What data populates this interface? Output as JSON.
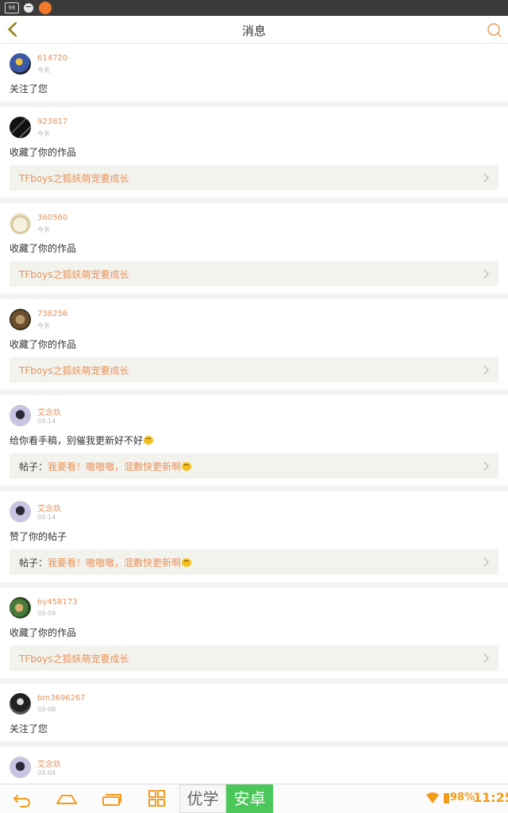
{
  "status_bar": {
    "badge": "96"
  },
  "header": {
    "title": "消息"
  },
  "messages": [
    {
      "user": "614720",
      "time": "今天",
      "action": "关注了您",
      "avatar": "avatar-blue-figure"
    },
    {
      "user": "923817",
      "time": "今天",
      "action": "收藏了你的作品",
      "ref": "TFboys之狐妖萌宠要成长",
      "avatar": "avatar-dark-sketch"
    },
    {
      "user": "360560",
      "time": "今天",
      "action": "收藏了你的作品",
      "ref": "TFboys之狐妖萌宠要成长",
      "avatar": "avatar-cream-cat"
    },
    {
      "user": "738256",
      "time": "今天",
      "action": "收藏了你的作品",
      "ref": "TFboys之狐妖萌宠要成长",
      "avatar": "avatar-brown-photo"
    },
    {
      "user": "艾念玖",
      "time": "03-14",
      "action": "给你看手稿，别催我更新好不好",
      "ref_prefix": "帖子：",
      "ref": "我要看！嗷嗷嗷，混敷快更新啊",
      "avatar": "avatar-girl-lavender"
    },
    {
      "user": "艾念玖",
      "time": "03-14",
      "action": "赞了你的帖子",
      "ref_prefix": "帖子：",
      "ref": "我要看！嗷嗷嗷，混敷快更新啊",
      "avatar": "avatar-girl-lavender"
    },
    {
      "user": "by458173",
      "time": "03-09",
      "action": "收藏了你的作品",
      "ref": "TFboys之狐妖萌宠要成长",
      "avatar": "avatar-green-figure"
    },
    {
      "user": "bm3696267",
      "time": "03-08",
      "action": "关注了您",
      "avatar": "avatar-bw-portrait"
    },
    {
      "user": "艾念玖",
      "time": "03-04",
      "avatar": "avatar-girl-lavender"
    }
  ],
  "navbar": {
    "brand_left": "优学",
    "brand_right": "安卓",
    "battery": "98%",
    "clock": "11:25"
  },
  "colors": {
    "accent": "#e8915a",
    "brand_green": "#4cc85a",
    "system_orange": "#f39c1b"
  }
}
